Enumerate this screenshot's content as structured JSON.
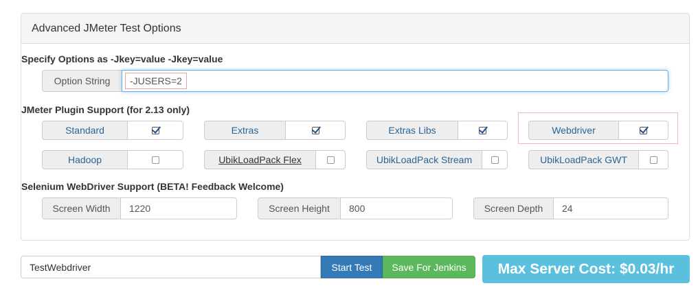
{
  "panel": {
    "title": "Advanced JMeter Test Options",
    "options_label": "Specify Options as -Jkey=value -Jkey=value",
    "option_string": {
      "label": "Option String",
      "value": "-JUSERS=2"
    },
    "plugins_label": "JMeter Plugin Support (for 2.13 only)",
    "plugins": [
      {
        "label": "Standard",
        "checked": true
      },
      {
        "label": "Extras",
        "checked": true
      },
      {
        "label": "Extras Libs",
        "checked": true
      },
      {
        "label": "Webdriver",
        "checked": true
      },
      {
        "label": "Hadoop",
        "checked": false
      },
      {
        "label": "UbikLoadPack Flex",
        "checked": false
      },
      {
        "label": "UbikLoadPack Stream",
        "checked": false
      },
      {
        "label": "UbikLoadPack GWT",
        "checked": false
      }
    ],
    "selenium_label": "Selenium WebDriver Support (BETA! Feedback Welcome)",
    "screen_width": {
      "label": "Screen Width",
      "value": "1220"
    },
    "screen_height": {
      "label": "Screen Height",
      "value": "800"
    },
    "screen_depth": {
      "label": "Screen Depth",
      "value": "24"
    }
  },
  "footer": {
    "test_name": "TestWebdriver",
    "start_label": "Start Test",
    "save_label": "Save For Jenkins",
    "cost_label": "Max Server Cost: $0.03/hr"
  },
  "colors": {
    "primary": "#337ab7",
    "success": "#5cb85c",
    "info": "#5bc0de",
    "link": "#2a6496"
  }
}
